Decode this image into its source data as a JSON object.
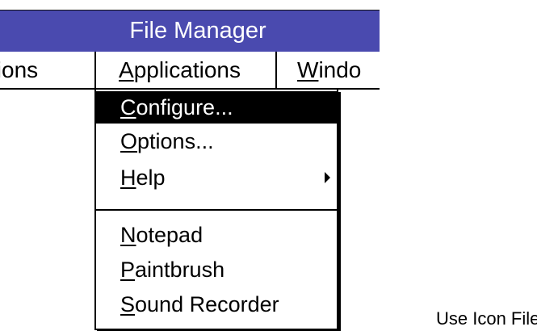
{
  "window": {
    "title": "File Manager"
  },
  "menubar": {
    "items": [
      {
        "prefix": "",
        "accel": "",
        "rest": "tions"
      },
      {
        "prefix": "",
        "accel": "A",
        "rest": "pplications"
      },
      {
        "prefix": "",
        "accel": "W",
        "rest": "indo"
      }
    ]
  },
  "applications_menu": {
    "items": [
      {
        "accel": "C",
        "rest": "onfigure...",
        "selected": true
      },
      {
        "accel": "O",
        "rest": "ptions..."
      },
      {
        "accel": "H",
        "rest": "elp",
        "has_submenu": true
      },
      {
        "accel": "N",
        "rest": "otepad"
      },
      {
        "accel": "P",
        "rest": "aintbrush"
      },
      {
        "accel": "S",
        "rest": "ound Recorder"
      }
    ]
  },
  "caption": "Use Icon File",
  "icons": {
    "submenu": "triangle-right-icon"
  }
}
